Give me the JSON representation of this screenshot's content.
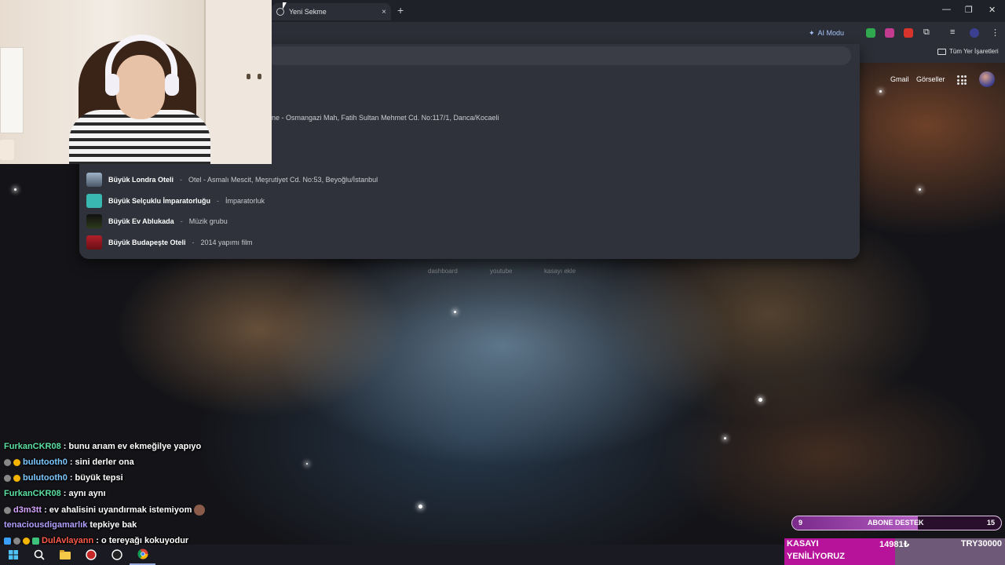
{
  "browser": {
    "tab_title": "Yeni Sekme",
    "tab_close": "×",
    "new_tab": "+",
    "ai_mode": "AI Modu",
    "all_bookmarks": "Tüm Yer İşaretleri",
    "gmail": "Gmail",
    "images": "Görseller"
  },
  "dropdown": {
    "partial_suggestion": "ne - Osmangazi Mah, Fatih Sultan Mehmet Cd. No:117/1, Danca/Kocaeli",
    "suggestions": [
      {
        "title": "Büyük Londra Oteli",
        "sep": "-",
        "detail": "Otel - Asmalı Mescit, Meşrutiyet Cd. No:53, Beyoğlu/İstanbul"
      },
      {
        "title": "Büyük Selçuklu İmparatorluğu",
        "sep": "-",
        "detail": "İmparatorluk"
      },
      {
        "title": "Büyük Ev Ablukada",
        "sep": "-",
        "detail": "Müzik grubu"
      },
      {
        "title": "Büyük Budapeşte Oteli",
        "sep": "-",
        "detail": "2014 yapımı film"
      }
    ]
  },
  "shortcuts": [
    "dashboard",
    "youtube",
    "kasayı ekle"
  ],
  "chat": [
    {
      "user": "FurkanCKR08",
      "message": ": bunu arıam ev ekmeğilye yapıyo"
    },
    {
      "user": "bulutooth0",
      "message": ": sini derler ona"
    },
    {
      "user": "bulutooth0",
      "message": ": büyük tepsi"
    },
    {
      "user": "FurkanCKR08",
      "message": ": aynı aynı"
    },
    {
      "user": "d3m3tt",
      "message": ": ev ahalisini uyandırmak istemiyom"
    },
    {
      "user": "tenaciousdigamarlık",
      "message": "tepkiye bak"
    },
    {
      "user": "DulAvlayann",
      "message": ": o tereyağı kokuyodur"
    }
  ],
  "overlay": {
    "sub_left": "9",
    "sub_label": "ABONE DESTEK",
    "sub_right": "15",
    "sub_progress": 0.6,
    "kasa_label_1": "KASAYI",
    "kasa_label_2": "YENİLİYORUZ",
    "kasa_amount": "14981₺",
    "kasa_goal": "TRY30000",
    "kasa_progress": 0.5
  },
  "colors": {
    "accent_ai": "#a8c7fa",
    "sub_fill": "#b25cc0",
    "kasa_fill": "#b6129a"
  }
}
